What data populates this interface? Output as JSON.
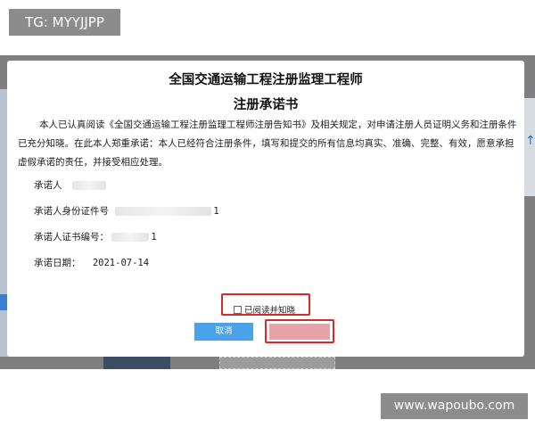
{
  "watermarks": {
    "top_left": "TG: MYYJJPP",
    "bottom_right": "www.wapoubo.com"
  },
  "dialog": {
    "title_line1": "全国交通运输工程注册监理工程师",
    "title_line2": "注册承诺书",
    "statement": "本人已认真阅读《全国交通运输工程注册监理工程师注册告知书》及相关规定，对申请注册人员证明义务和注册条件已充分知晓。在此本人郑重承诺：本人已经符合注册条件，填写和提交的所有信息均真实、准确、完整、有效，愿意承担虚假承诺的责任，并接受相应处理。",
    "fields": {
      "promisor_label": "承诺人",
      "id_number_label": "承诺人身份证件号",
      "id_number_suffix": "1",
      "cert_number_label": "承诺人证书编号：",
      "cert_number_suffix": "1",
      "date_label": "承诺日期：",
      "date_value": "2021-07-14"
    },
    "agree_label": "已阅读并知晓",
    "cancel_label": "取消"
  },
  "colors": {
    "highlight": "#d42a2a",
    "cancel_button": "#4aa3e8",
    "confirm_button": "#e8a3a8"
  }
}
